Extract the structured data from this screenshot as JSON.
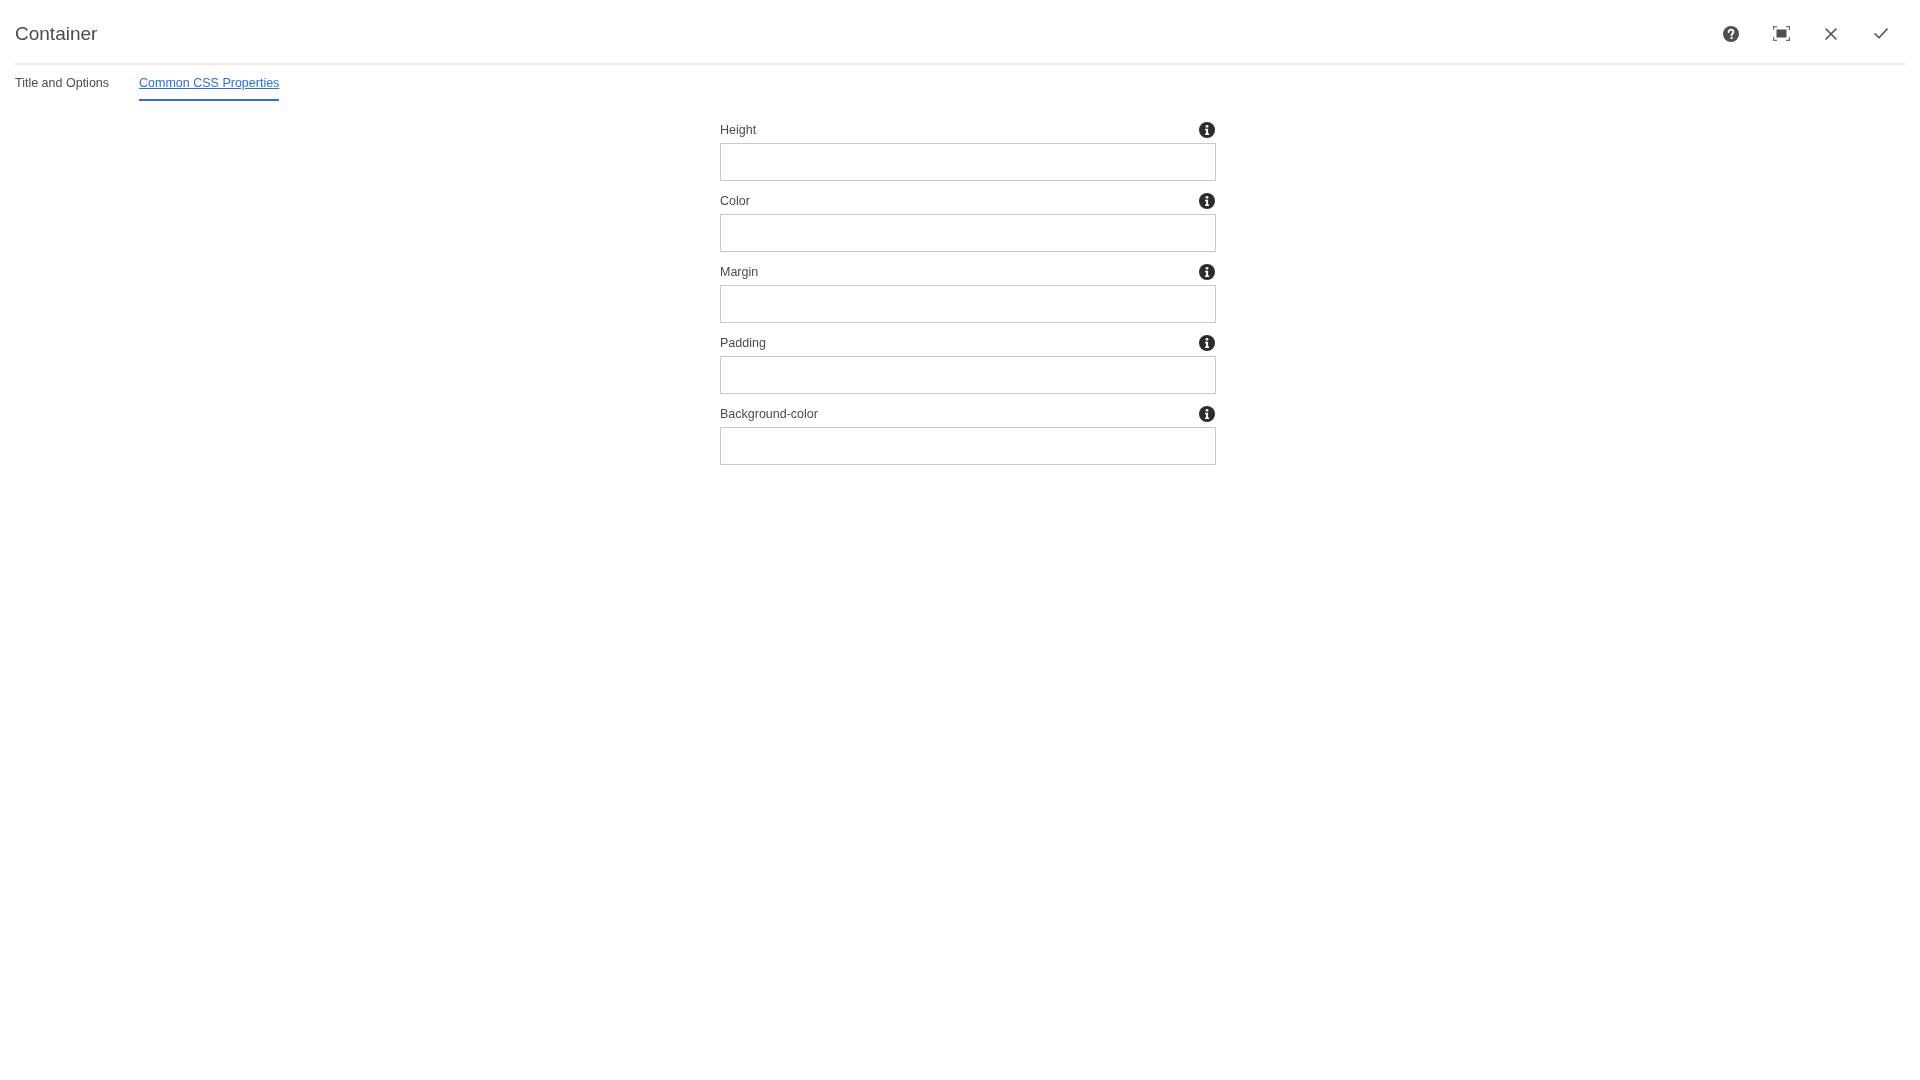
{
  "dialog": {
    "title": "Container"
  },
  "tabs": [
    {
      "label": "Title and Options",
      "selected": false
    },
    {
      "label": "Common CSS Properties",
      "selected": true
    }
  ],
  "fields": [
    {
      "label": "Height"
    },
    {
      "label": "Color"
    },
    {
      "label": "Margin"
    },
    {
      "label": "Padding"
    },
    {
      "label": "Background-color"
    }
  ]
}
